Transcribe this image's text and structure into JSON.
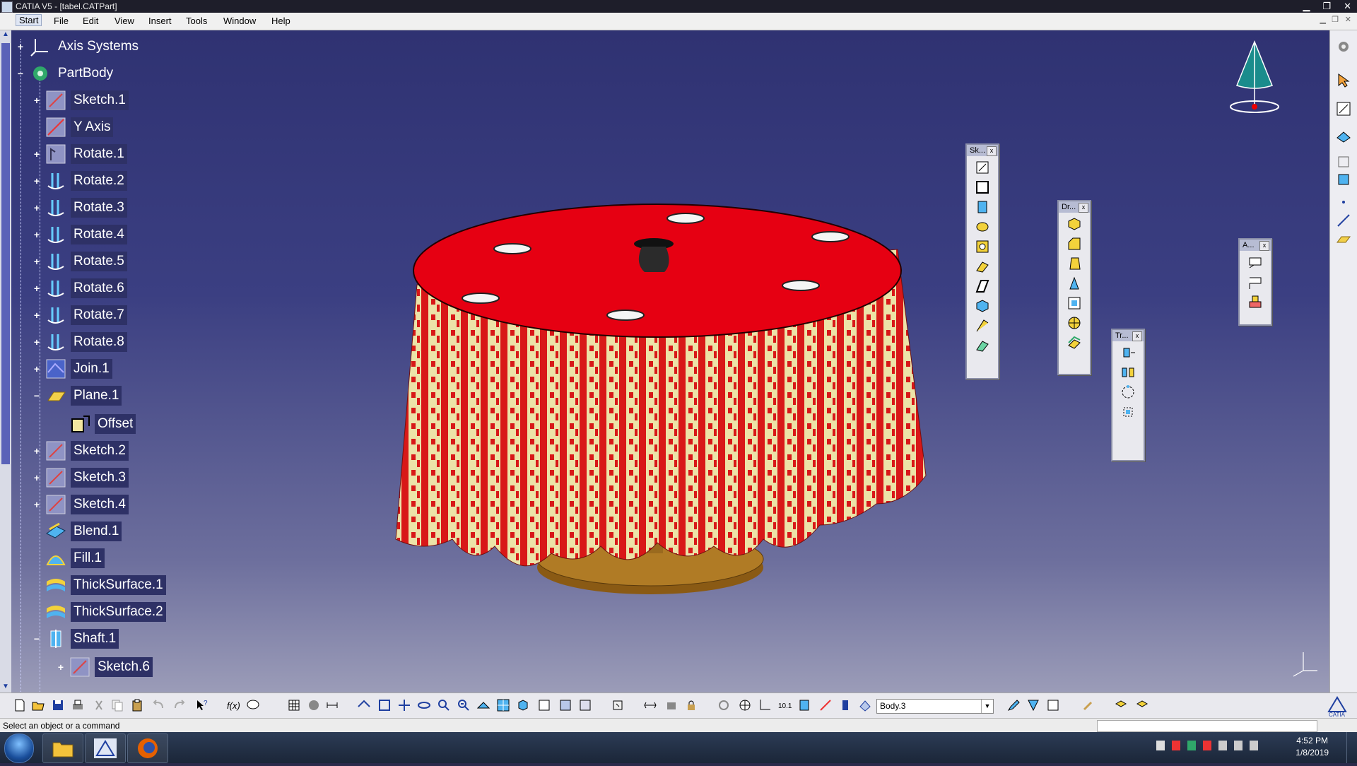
{
  "window": {
    "title": "CATIA V5 - [tabel.CATPart]",
    "controls": [
      "minimize-icon",
      "restore-icon",
      "close-icon"
    ]
  },
  "menu": {
    "items": [
      "Start",
      "File",
      "Edit",
      "View",
      "Insert",
      "Tools",
      "Window",
      "Help"
    ]
  },
  "tree": {
    "nodes": [
      {
        "label": "Axis Systems",
        "icon": "axis-system-icon",
        "level": 0,
        "expander": "+"
      },
      {
        "label": "PartBody",
        "icon": "part-body-icon",
        "level": 0,
        "expander": "−"
      },
      {
        "label": "Sketch.1",
        "icon": "sketch-icon",
        "level": 1,
        "expander": "+"
      },
      {
        "label": "Y Axis",
        "icon": "line-icon",
        "level": 1,
        "expander": ""
      },
      {
        "label": "Rotate.1",
        "icon": "rotate-icon",
        "level": 1,
        "expander": "+"
      },
      {
        "label": "Rotate.2",
        "icon": "rotate-icon",
        "level": 1,
        "expander": "+"
      },
      {
        "label": "Rotate.3",
        "icon": "rotate-icon",
        "level": 1,
        "expander": "+"
      },
      {
        "label": "Rotate.4",
        "icon": "rotate-icon",
        "level": 1,
        "expander": "+"
      },
      {
        "label": "Rotate.5",
        "icon": "rotate-icon",
        "level": 1,
        "expander": "+"
      },
      {
        "label": "Rotate.6",
        "icon": "rotate-icon",
        "level": 1,
        "expander": "+"
      },
      {
        "label": "Rotate.7",
        "icon": "rotate-icon",
        "level": 1,
        "expander": "+"
      },
      {
        "label": "Rotate.8",
        "icon": "rotate-icon",
        "level": 1,
        "expander": "+"
      },
      {
        "label": "Join.1",
        "icon": "join-icon",
        "level": 1,
        "expander": "+"
      },
      {
        "label": "Plane.1",
        "icon": "plane-icon",
        "level": 1,
        "expander": "−"
      },
      {
        "label": "Offset",
        "icon": "offset-icon",
        "level": 2,
        "expander": ""
      },
      {
        "label": "Sketch.2",
        "icon": "sketch-icon",
        "level": 1,
        "expander": "+"
      },
      {
        "label": "Sketch.3",
        "icon": "sketch-icon",
        "level": 1,
        "expander": "+"
      },
      {
        "label": "Sketch.4",
        "icon": "sketch-icon",
        "level": 1,
        "expander": "+"
      },
      {
        "label": "Blend.1",
        "icon": "blend-icon",
        "level": 1,
        "expander": ""
      },
      {
        "label": "Fill.1",
        "icon": "fill-icon",
        "level": 1,
        "expander": ""
      },
      {
        "label": "ThickSurface.1",
        "icon": "thick-surface-icon",
        "level": 1,
        "expander": ""
      },
      {
        "label": "ThickSurface.2",
        "icon": "thick-surface-icon",
        "level": 1,
        "expander": ""
      },
      {
        "label": "Shaft.1",
        "icon": "shaft-icon",
        "level": 1,
        "expander": "−"
      },
      {
        "label": "Sketch.6",
        "icon": "sketch-icon",
        "level": 2,
        "expander": "+"
      }
    ]
  },
  "panels": {
    "sketch": {
      "title": "Sk...",
      "close": "x"
    },
    "dress_up": {
      "title": "Dr...",
      "close": "x"
    },
    "transform": {
      "title": "Tr...",
      "close": "x"
    },
    "annotation": {
      "title": "A...",
      "close": "x"
    }
  },
  "bottom_toolbar": {
    "body_select": "Body.3"
  },
  "status": {
    "message": "Select an object or a command"
  },
  "taskbar": {
    "time": "4:52 PM",
    "date": "1/8/2019"
  },
  "colors": {
    "table_top": "#e60012",
    "cloth_red": "#d81818",
    "cloth_cream": "#ece3a8",
    "wood": "#a8741e",
    "background_top": "#2f3272",
    "background_bottom": "#9b9cb8"
  }
}
